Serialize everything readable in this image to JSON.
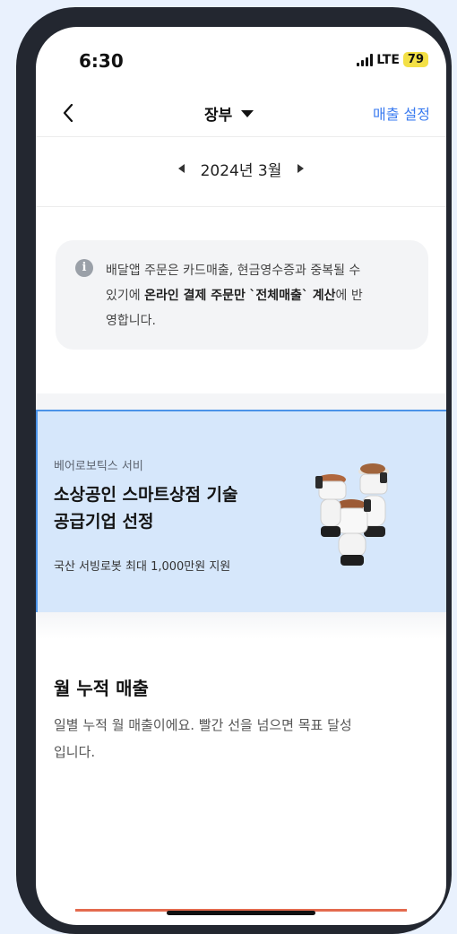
{
  "status_bar": {
    "time": "6:30",
    "network": "LTE",
    "battery": "79"
  },
  "nav": {
    "title": "장부",
    "right_action": "매출 설정"
  },
  "month_nav": {
    "label": "2024년 3월"
  },
  "notice": {
    "line1": "배달앱 주문은 카드매출, 현금영수증과 중복될 수",
    "line2_plain_before": "있기에 ",
    "line2_bold1": "온라인 결제 주문만",
    "line2_plain_mid": " ",
    "line2_bold2": "`전체매출` 계산",
    "line2_plain_after": "에 반",
    "line3": "영합니다."
  },
  "banner": {
    "kicker": "베어로보틱스 서비",
    "title_line1": "소상공인 스마트상점 기술",
    "title_line2": "공급기업 선정",
    "subtitle": "국산 서빙로봇 최대 1,000만원 지원"
  },
  "section": {
    "title": "월 누적 매출",
    "desc_line1": "일별 누적 월 매출이에요. 빨간 선을 넘으면 목표 달성",
    "desc_line2": "입니다."
  }
}
